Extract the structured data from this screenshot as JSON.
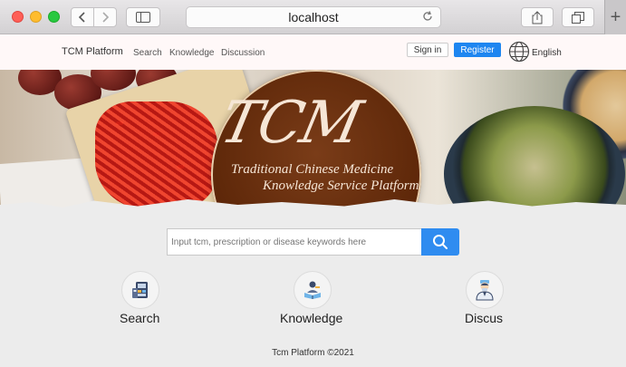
{
  "browser": {
    "address": "localhost",
    "icons": {
      "back": "chevron-left-icon",
      "forward": "chevron-right-icon",
      "sidebar": "sidebar-icon",
      "reload": "reload-icon",
      "share": "share-icon",
      "tabs": "tab-overview-icon",
      "new_tab": "plus-icon"
    }
  },
  "header": {
    "brand": "TCM Platform",
    "nav": [
      "Search",
      "Knowledge",
      "Discussion"
    ],
    "sign_in": "Sign in",
    "register": "Register",
    "language": "English"
  },
  "hero": {
    "logo": "TCM",
    "tagline_line1": "Traditional Chinese Medicine",
    "tagline_line2": "Knowledge Service Platform"
  },
  "search": {
    "placeholder": "Input tcm, prescription or disease keywords here"
  },
  "features": [
    {
      "label": "Search",
      "icon": "medicine-box-icon"
    },
    {
      "label": "Knowledge",
      "icon": "reading-person-icon"
    },
    {
      "label": "Discus",
      "icon": "doctor-icon"
    }
  ],
  "footer": "Tcm Platform ©2021",
  "colors": {
    "accent": "#1e86f0",
    "search_button": "#2f8cf0",
    "seal": "#5c2608"
  }
}
